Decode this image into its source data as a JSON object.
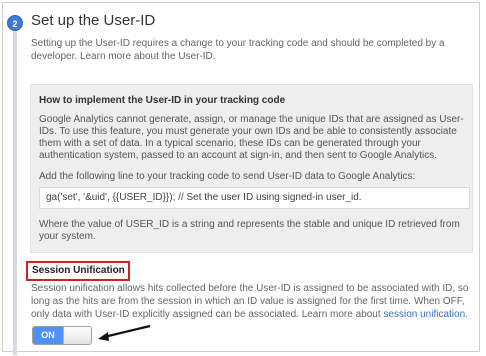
{
  "step": {
    "number": "2",
    "title": "Set up the User-ID",
    "intro_text": "Setting up the User-ID requires a change to your tracking code and should be completed by a developer.",
    "intro_link": "Learn more about the User-ID."
  },
  "info_box": {
    "title": "How to implement the User-ID in your tracking code",
    "body": "Google Analytics cannot generate, assign, or manage the unique IDs that are assigned as User-IDs. To use this feature, you must generate your own IDs and be able to consistently associate them with a set of data. In a typical scenario, these IDs can be generated through your authentication system, passed to an account at sign-in, and then sent to Google Analytics.",
    "add_line_text": "Add the following line to your tracking code to send User-ID data to Google Analytics:",
    "code": "ga('set', '&uid', {{USER_ID}}); // Set the user ID using signed-in user_id.",
    "where_text": "Where the value of USER_ID is a string and represents the stable and unique ID retrieved from your system."
  },
  "session_unification": {
    "heading": "Session Unification",
    "description": "Session unification allows hits collected before the User-ID is assigned to be associated with ID, so long as the hits are from the session in which an ID value is assigned for the first time. When OFF, only data with User-ID explicitly assigned can be associated. Learn more about",
    "link_text": "session unification.",
    "toggle_label": "ON",
    "toggle_state": "on"
  },
  "colors": {
    "accent": "#4d90fe",
    "highlight_border": "#d42020",
    "step_badge": "#3f7bd6"
  }
}
